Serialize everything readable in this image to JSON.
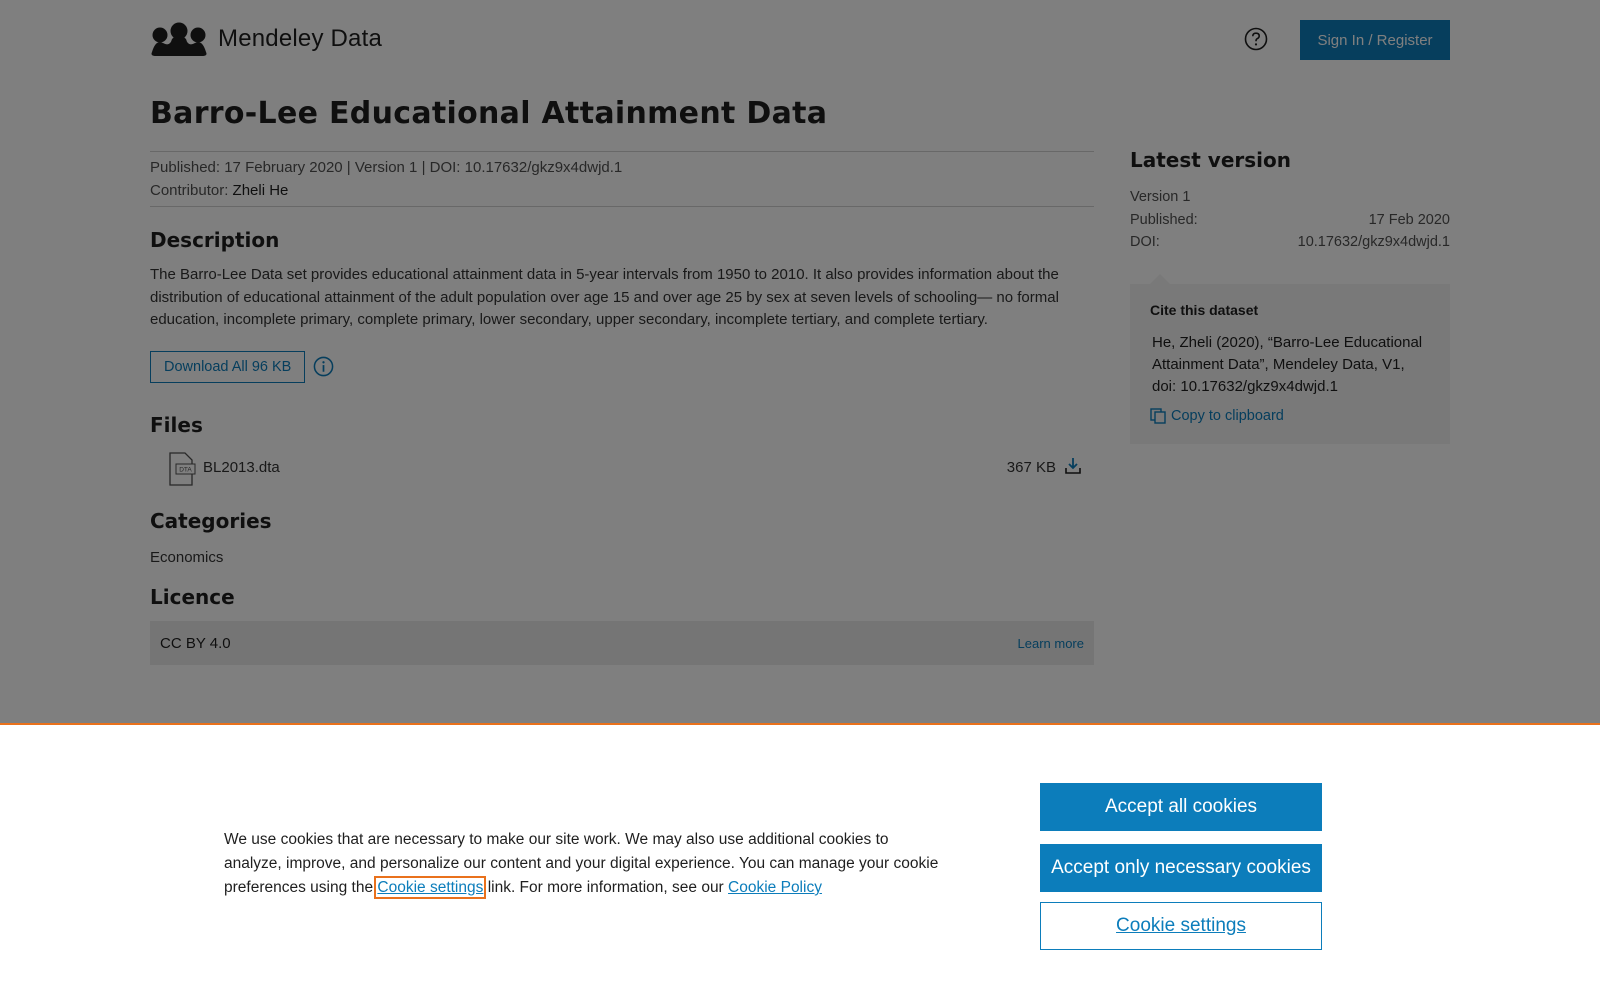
{
  "header": {
    "logo_text": "Mendeley Data",
    "help_icon": "question-circle-icon",
    "signin_label": "Sign In / Register"
  },
  "dataset": {
    "title": "Barro-Lee Educational Attainment Data",
    "meta_line": "Published: 17 February 2020 | Version 1 | DOI: 10.17632/gkz9x4dwjd.1",
    "contributor_label": "Contributor:",
    "contributor_name": "Zheli He"
  },
  "description": {
    "heading": "Description",
    "text": "The Barro-Lee Data set provides educational attainment data in 5-year intervals from 1950 to 2010. It also provides information about the distribution of educational attainment of the adult population over age 15 and over age 25 by sex at seven levels of schooling— no formal education, incomplete primary, complete primary, lower secondary, upper secondary, incomplete tertiary, and complete tertiary.",
    "download_label": "Download All 96 KB"
  },
  "files": {
    "heading": "Files",
    "items": [
      {
        "icon_label": "DTA",
        "name": "BL2013.dta",
        "size": "367 KB"
      }
    ]
  },
  "categories": {
    "heading": "Categories",
    "items": [
      "Economics"
    ]
  },
  "licence": {
    "heading": "Licence",
    "name": "CC BY 4.0",
    "learn_more": "Learn more"
  },
  "sidebar": {
    "heading": "Latest version",
    "version": "Version 1",
    "published_label": "Published:",
    "published_value": "17 Feb 2020",
    "doi_label": "DOI:",
    "doi_value": "10.17632/gkz9x4dwjd.1",
    "cite_heading": "Cite this dataset",
    "cite_text": "He, Zheli (2020), “Barro-Lee Educational Attainment Data”, Mendeley Data, V1, doi: 10.17632/gkz9x4dwjd.1",
    "copy_label": "Copy to clipboard"
  },
  "cookie_banner": {
    "text_before": "We use cookies that are necessary to make our site work. We may also use additional cookies to analyze, improve, and personalize our content and your digital experience. You can manage your cookie preferences using the",
    "settings_link": "Cookie settings",
    "text_after": "link. For more information, see our",
    "policy_link": "Cookie Policy",
    "accept_all": "Accept all cookies",
    "accept_necessary": "Accept only necessary cookies",
    "settings_button": "Cookie settings"
  },
  "colors": {
    "brand_blue": "#0c7dbb",
    "focus_orange": "#e9711c"
  }
}
